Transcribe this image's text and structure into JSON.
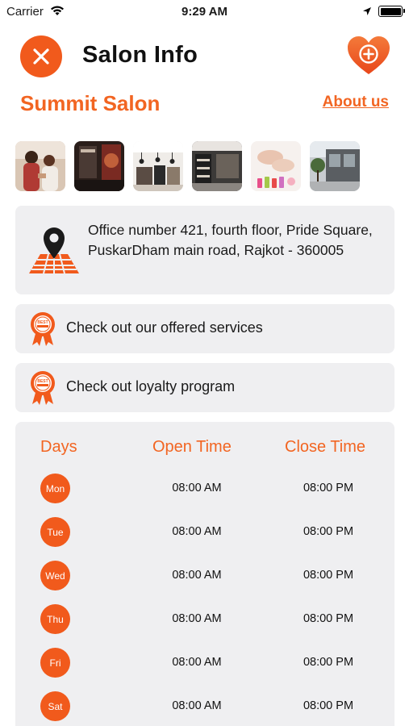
{
  "status_bar": {
    "carrier": "Carrier",
    "time": "9:29 AM"
  },
  "header": {
    "title": "Salon Info"
  },
  "salon": {
    "name": "Summit Salon",
    "about_label": "About us"
  },
  "gallery": {
    "photos": [
      "salon-staff-photo",
      "salon-mirror-station-photo",
      "salon-interior-photo",
      "salon-retail-shelves-photo",
      "manicure-photo",
      "salon-storefront-photo"
    ]
  },
  "address": {
    "text": "Office number 421, fourth floor, Pride Square, PuskarDham main road, Rajkot - 360005"
  },
  "links": {
    "services_label": "Check out our offered services",
    "loyalty_label": "Check out loyalty program"
  },
  "hours": {
    "headers": {
      "days": "Days",
      "open": "Open Time",
      "close": "Close Time"
    },
    "rows": [
      {
        "day": "Mon",
        "open": "08:00 AM",
        "close": "08:00 PM"
      },
      {
        "day": "Tue",
        "open": "08:00 AM",
        "close": "08:00 PM"
      },
      {
        "day": "Wed",
        "open": "08:00 AM",
        "close": "08:00 PM"
      },
      {
        "day": "Thu",
        "open": "08:00 AM",
        "close": "08:00 PM"
      },
      {
        "day": "Fri",
        "open": "08:00 AM",
        "close": "08:00 PM"
      },
      {
        "day": "Sat",
        "open": "08:00 AM",
        "close": "08:00 PM"
      }
    ]
  },
  "colors": {
    "accent": "#f15a1c",
    "accent_text": "#f26522",
    "card_bg": "#efeff1"
  }
}
